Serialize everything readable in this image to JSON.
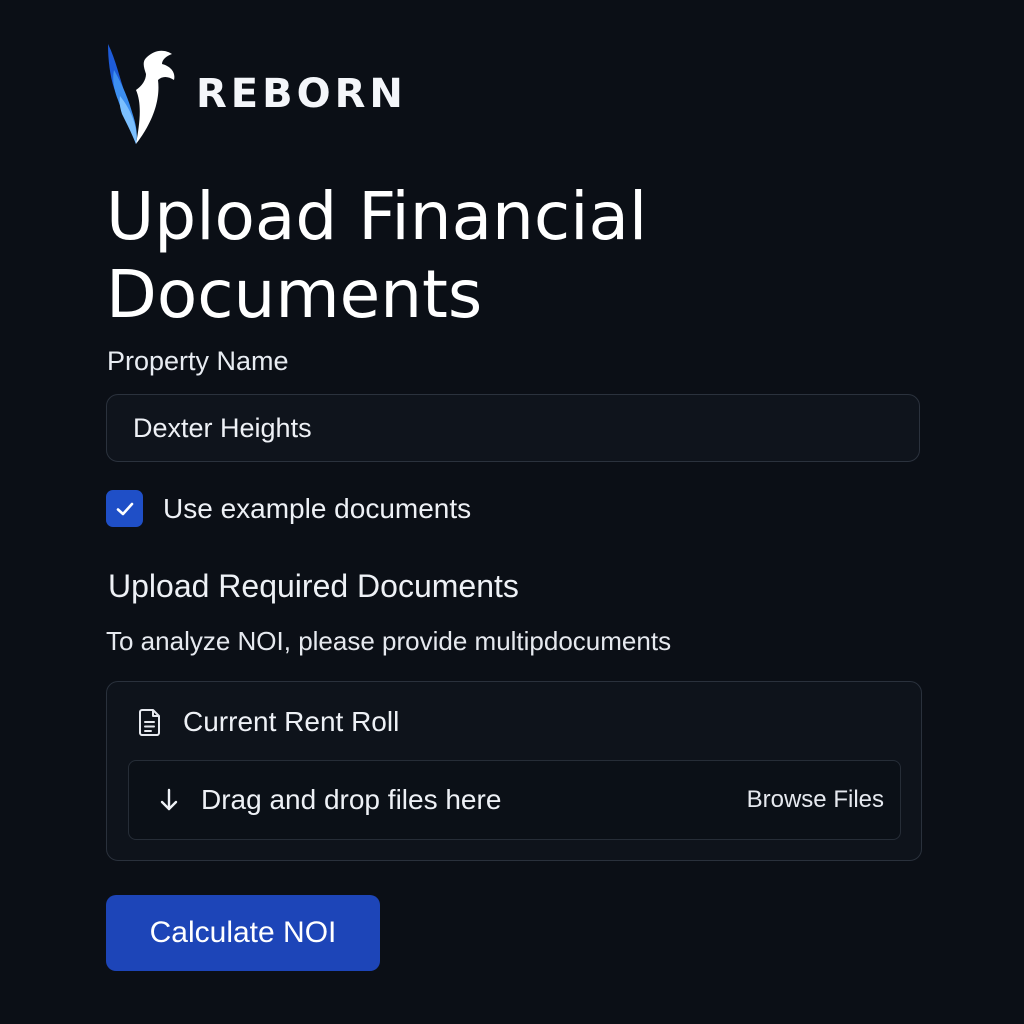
{
  "brand": {
    "name": "REBORN",
    "logo_icon": "phoenix-logo-icon",
    "logo_colors": [
      "#1e5bd8",
      "#4aa3f5",
      "#ffffff"
    ]
  },
  "page": {
    "title": "Upload Financial Documents"
  },
  "property_field": {
    "label": "Property Name",
    "value": "Dexter Heights",
    "placeholder": ""
  },
  "example_docs": {
    "label": "Use example documents",
    "checked": true
  },
  "upload_section": {
    "title": "Upload Required Documents",
    "description": "To analyze NOI, please provide multipdocuments"
  },
  "document_card": {
    "icon": "document-icon",
    "title": "Current Rent Roll",
    "dropzone_icon": "down-arrow-icon",
    "dropzone_text": "Drag and drop files here",
    "browse_label": "Browse Files"
  },
  "actions": {
    "calculate_label": "Calculate NOI"
  },
  "colors": {
    "background": "#0b0f16",
    "accent": "#1d45b8",
    "checkbox": "#1f4fc7",
    "border": "#2a313c"
  }
}
